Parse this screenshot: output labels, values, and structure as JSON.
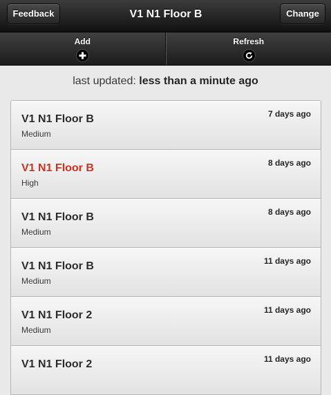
{
  "header": {
    "feedback_label": "Feedback",
    "title": "V1 N1 Floor B",
    "change_label": "Change"
  },
  "navbar": {
    "items": [
      {
        "label": "Add",
        "icon": "plus-icon"
      },
      {
        "label": "Refresh",
        "icon": "refresh-icon"
      }
    ]
  },
  "status": {
    "prefix": "last updated:",
    "value": "less than a minute ago"
  },
  "colors": {
    "high_priority": "#c8321e"
  },
  "reports": [
    {
      "title": "V1 N1 Floor B",
      "priority": "Medium",
      "age": "7 days ago"
    },
    {
      "title": "V1 N1 Floor B",
      "priority": "High",
      "age": "8 days ago"
    },
    {
      "title": "V1 N1 Floor B",
      "priority": "Medium",
      "age": "8 days ago"
    },
    {
      "title": "V1 N1 Floor B",
      "priority": "Medium",
      "age": "11 days ago"
    },
    {
      "title": "V1 N1 Floor 2",
      "priority": "Medium",
      "age": "11 days ago"
    },
    {
      "title": "V1 N1 Floor 2",
      "priority": "",
      "age": "11 days ago"
    }
  ]
}
